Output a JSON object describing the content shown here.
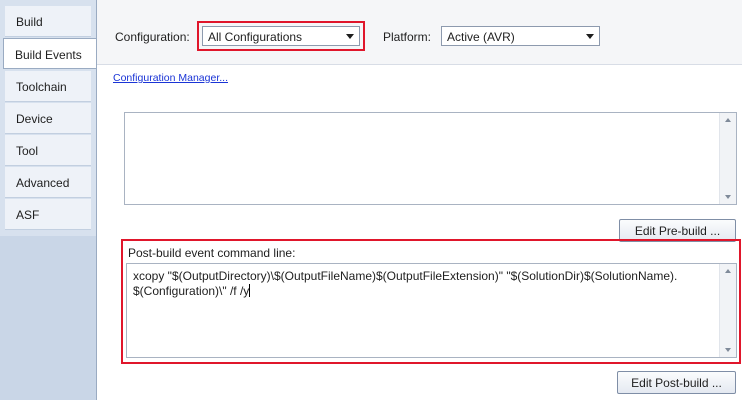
{
  "sidebar": {
    "tabs": [
      {
        "label": "Build"
      },
      {
        "label": "Build Events"
      },
      {
        "label": "Toolchain"
      },
      {
        "label": "Device"
      },
      {
        "label": "Tool"
      },
      {
        "label": "Advanced"
      },
      {
        "label": "ASF"
      }
    ],
    "active_tab": "Build Events"
  },
  "header": {
    "configuration_label": "Configuration:",
    "configuration_value": "All Configurations",
    "platform_label": "Platform:",
    "platform_value": "Active (AVR)"
  },
  "config_manager_link": "Configuration Manager...",
  "pre_build": {
    "value": "",
    "edit_button": "Edit Pre-build ..."
  },
  "post_build": {
    "label": "Post-build event command line:",
    "value": "xcopy \"$(OutputDirectory)\\$(OutputFileName)$(OutputFileExtension)\" \"$(SolutionDir)$(SolutionName).\n$(Configuration)\\\" /f /y",
    "edit_button": "Edit Post-build ..."
  },
  "colors": {
    "highlight": "#e0162b",
    "link": "#1a34d6",
    "sidebar_bg": "#d7e1ee"
  }
}
